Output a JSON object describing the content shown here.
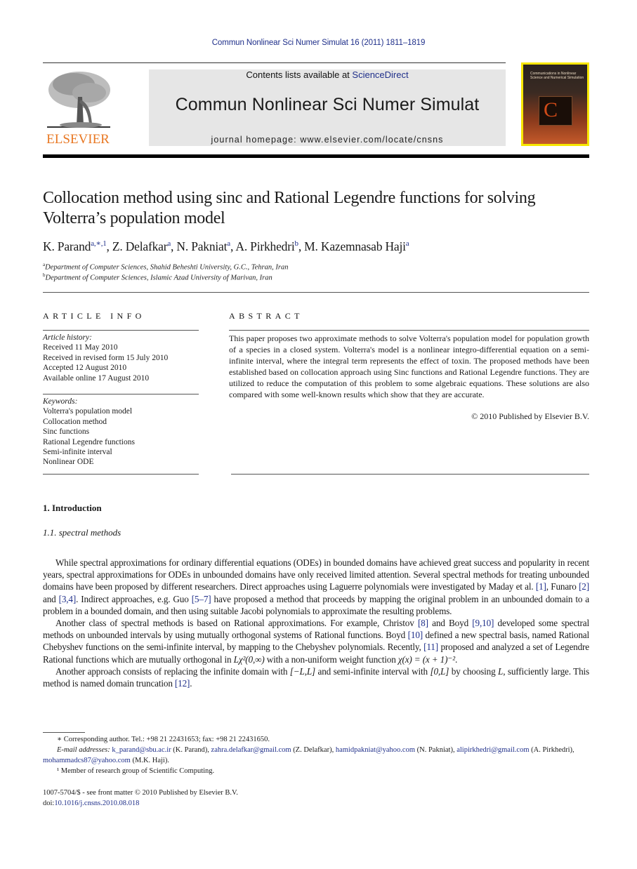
{
  "header": {
    "running_head": "Commun Nonlinear Sci Numer Simulat 16 (2011) 1811–1819",
    "publisher_logo": "ELSEVIER",
    "contents_prefix": "Contents lists available at ",
    "contents_link": "ScienceDirect",
    "journal_title": "Commun Nonlinear Sci Numer Simulat",
    "homepage_label": "journal homepage: ",
    "homepage_url": "www.elsevier.com/locate/cnsns",
    "cover_title": "Communications in Nonlinear Science and Numerical Simulation",
    "colors": {
      "link": "#1f2f8a",
      "elsevier_orange": "#e87722",
      "cover_border": "#f7e600",
      "journal_box": "#e6e6e6"
    }
  },
  "article": {
    "title": "Collocation method using sinc and Rational Legendre functions for solving Volterra’s population model",
    "authors": [
      {
        "name": "K. Parand",
        "sup": "a,∗,1"
      },
      {
        "name": "Z. Delafkar",
        "sup": "a"
      },
      {
        "name": "N. Pakniat",
        "sup": "a"
      },
      {
        "name": "A. Pirkhedri",
        "sup": "b"
      },
      {
        "name": "M. Kazemnasab Haji",
        "sup": "a"
      }
    ],
    "affiliations": [
      {
        "key": "a",
        "text": "Department of Computer Sciences, Shahid Beheshti University, G.C., Tehran, Iran"
      },
      {
        "key": "b",
        "text": "Department of Computer Sciences, Islamic Azad University of Marivan, Iran"
      }
    ]
  },
  "article_info": {
    "heading": "ARTICLE INFO",
    "history_label": "Article history:",
    "history": [
      "Received 11 May 2010",
      "Received in revised form 15 July 2010",
      "Accepted 12 August 2010",
      "Available online 17 August 2010"
    ],
    "keywords_label": "Keywords:",
    "keywords": [
      "Volterra's population model",
      "Collocation method",
      "Sinc functions",
      "Rational Legendre functions",
      "Semi-infinite interval",
      "Nonlinear ODE"
    ]
  },
  "abstract": {
    "heading": "ABSTRACT",
    "text": "This paper proposes two approximate methods to solve Volterra's population model for population growth of a species in a closed system. Volterra's model is a nonlinear integro-differential equation on a semi-infinite interval, where the integral term represents the effect of toxin. The proposed methods have been established based on collocation approach using Sinc functions and Rational Legendre functions. They are utilized to reduce the computation of this problem to some algebraic equations. These solutions are also compared with some well-known results which show that they are accurate.",
    "copyright": "© 2010 Published by Elsevier B.V."
  },
  "body": {
    "section_heading": "1. Introduction",
    "subsection_heading": "1.1. spectral methods",
    "p1": {
      "t1": "While spectral approximations for ordinary differential equations (ODEs) in bounded domains have achieved great success and popularity in recent years, spectral approximations for ODEs in unbounded domains have only received limited attention. Several spectral methods for treating unbounded domains have been proposed by different researchers. Direct approaches using Laguerre polynomials were investigated by Maday et al. ",
      "r1": "[1]",
      "t2": ", Funaro ",
      "r2": "[2]",
      "t3": " and ",
      "r3": "[3,4]",
      "t4": ". Indirect approaches, e.g. Guo ",
      "r4": "[5–7]",
      "t5": " have proposed a method that proceeds by mapping the original problem in an unbounded domain to a problem in a bounded domain, and then using suitable Jacobi polynomials to approximate the resulting problems."
    },
    "p2": {
      "t1": "Another class of spectral methods is based on Rational approximations. For example, Christov ",
      "r1": "[8]",
      "t2": " and Boyd ",
      "r2": "[9,10]",
      "t3": " developed some spectral methods on unbounded intervals by using mutually orthogonal systems of Rational functions. Boyd ",
      "r3": "[10]",
      "t4": " defined a new spectral basis, named Rational Chebyshev functions on the semi-infinite interval, by mapping to the Chebyshev polynomials. Recently, ",
      "r4": "[11]",
      "t5": " proposed and analyzed a set of Legendre Rational functions which are mutually orthogonal in ",
      "m1": "Lχ²(0,∞)",
      "t6": " with a non-uniform weight function ",
      "m2": "χ(x) = (x + 1)⁻²",
      "t7": "."
    },
    "p3": {
      "t1": "Another approach consists of replacing the infinite domain with ",
      "m1": "[−L,L]",
      "t2": " and semi-infinite interval with ",
      "m2": "[0,L]",
      "t3": " by choosing ",
      "m3": "L",
      "t4": ", sufficiently large. This method is named domain truncation ",
      "r1": "[12]",
      "t5": "."
    }
  },
  "footnotes": {
    "corresponding": "∗  Corresponding author. Tel.: +98 21 22431653; fax: +98 21 22431650.",
    "email_label": "E-mail addresses:",
    "emails": [
      {
        "addr": "k_parand@sbu.ac.ir",
        "who": " (K. Parand), "
      },
      {
        "addr": "zahra.delafkar@gmail.com",
        "who": " (Z. Delafkar), "
      },
      {
        "addr": "hamidpakniat@yahoo.com",
        "who": " (N. Pakniat), "
      },
      {
        "addr": "alipirkhedri@gmail.com",
        "who": " (A. Pirkhedri), "
      },
      {
        "addr": "mohammadcs87@yahoo.com",
        "who": " (M.K. Haji)."
      }
    ],
    "member": "¹  Member of research group of Scientific Computing.",
    "issn": "1007-5704/$ - see front matter © 2010 Published by Elsevier B.V.",
    "doi_label": "doi:",
    "doi": "10.1016/j.cnsns.2010.08.018"
  }
}
